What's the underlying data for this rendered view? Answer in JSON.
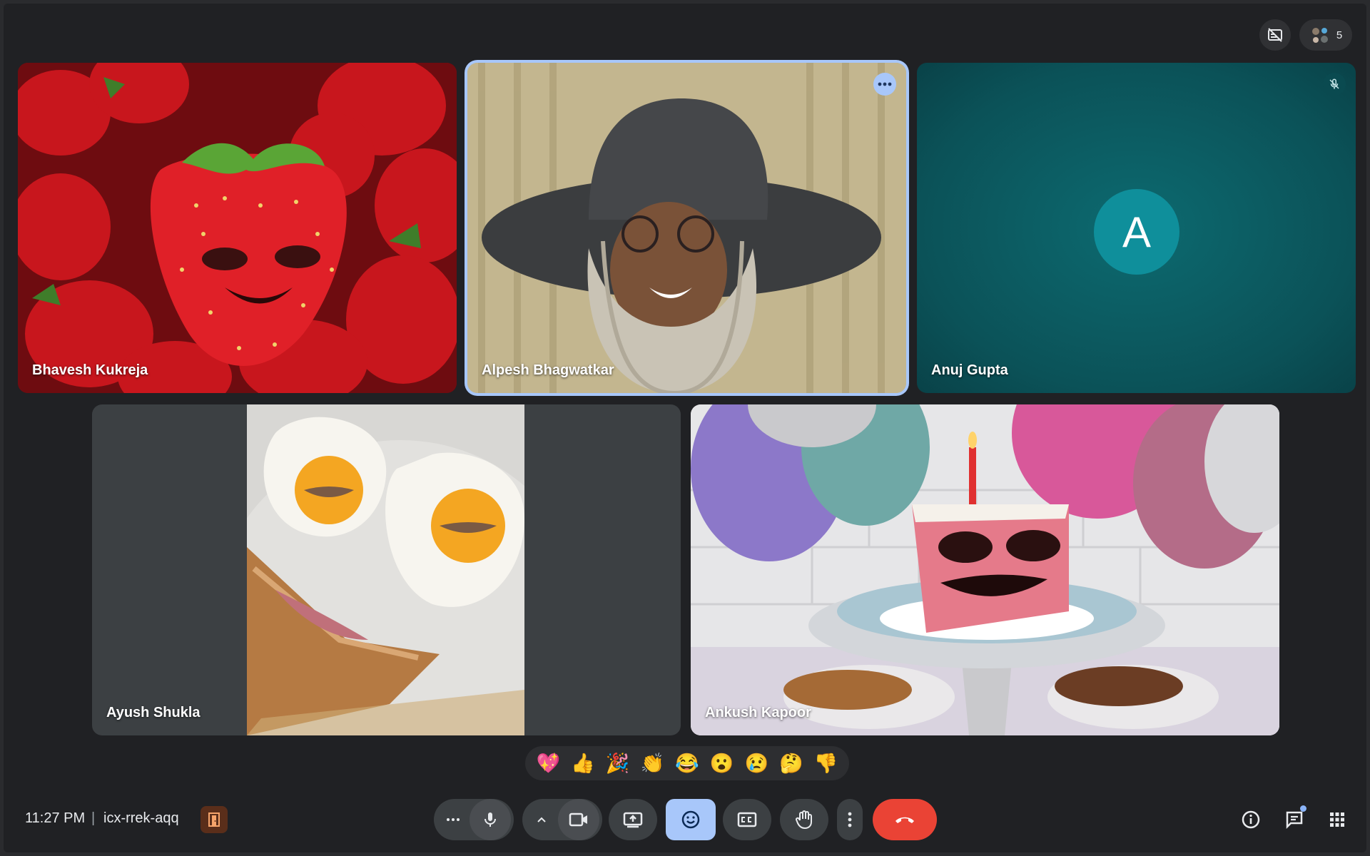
{
  "top": {
    "participants_count": "5"
  },
  "tiles": [
    {
      "name": "Bhavesh Kukreja"
    },
    {
      "name": "Alpesh Bhagwatkar"
    },
    {
      "name": "Anuj Gupta",
      "avatar_letter": "A"
    },
    {
      "name": "Ayush Shukla"
    },
    {
      "name": "Ankush Kapoor"
    }
  ],
  "reactions": [
    "💖",
    "👍",
    "🎉",
    "👏",
    "😂",
    "😮",
    "😢",
    "🤔",
    "👎"
  ],
  "footer": {
    "time": "11:27 PM",
    "separator": "|",
    "meeting_code": "icx-rrek-aqq"
  },
  "colors": {
    "accent": "#a8c7fa",
    "end_call": "#ea4335",
    "avatar_bg": "#0f8f9b",
    "anuj_tile": "#0d5a60"
  }
}
